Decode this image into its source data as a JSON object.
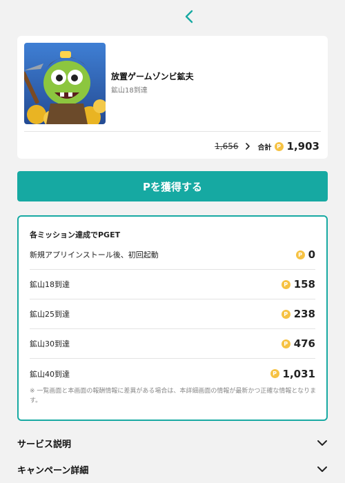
{
  "app": {
    "title": "放置ゲームゾンビ鉱夫",
    "subtitle": "鉱山18到達",
    "old_points": "1,656",
    "total_label": "合計",
    "total_points": "1,903"
  },
  "cta_label": "Pを獲得する",
  "coin_symbol": "P",
  "missions": {
    "heading": "各ミッション達成でPGET",
    "items": [
      {
        "label": "新規アプリインストール後、初回起動",
        "points": "0"
      },
      {
        "label": "鉱山18到達",
        "points": "158"
      },
      {
        "label": "鉱山25到達",
        "points": "238"
      },
      {
        "label": "鉱山30到達",
        "points": "476"
      },
      {
        "label": "鉱山40到達",
        "points": "1,031"
      }
    ],
    "note": "※ 一覧画面と本画面の報酬情報に差異がある場合は、本詳細画面の情報が最新かつ正確な情報となります。"
  },
  "accordions": [
    {
      "label": "サービス説明"
    },
    {
      "label": "キャンペーン詳細"
    }
  ],
  "colors": {
    "accent": "#16a9a2",
    "coin": "#f6c243",
    "background": "#f2f2f2"
  },
  "icons": {
    "back": "chevron-left-icon",
    "expand": "chevron-down-icon",
    "arrow": "chevron-right-icon",
    "coin": "point-coin-icon"
  }
}
